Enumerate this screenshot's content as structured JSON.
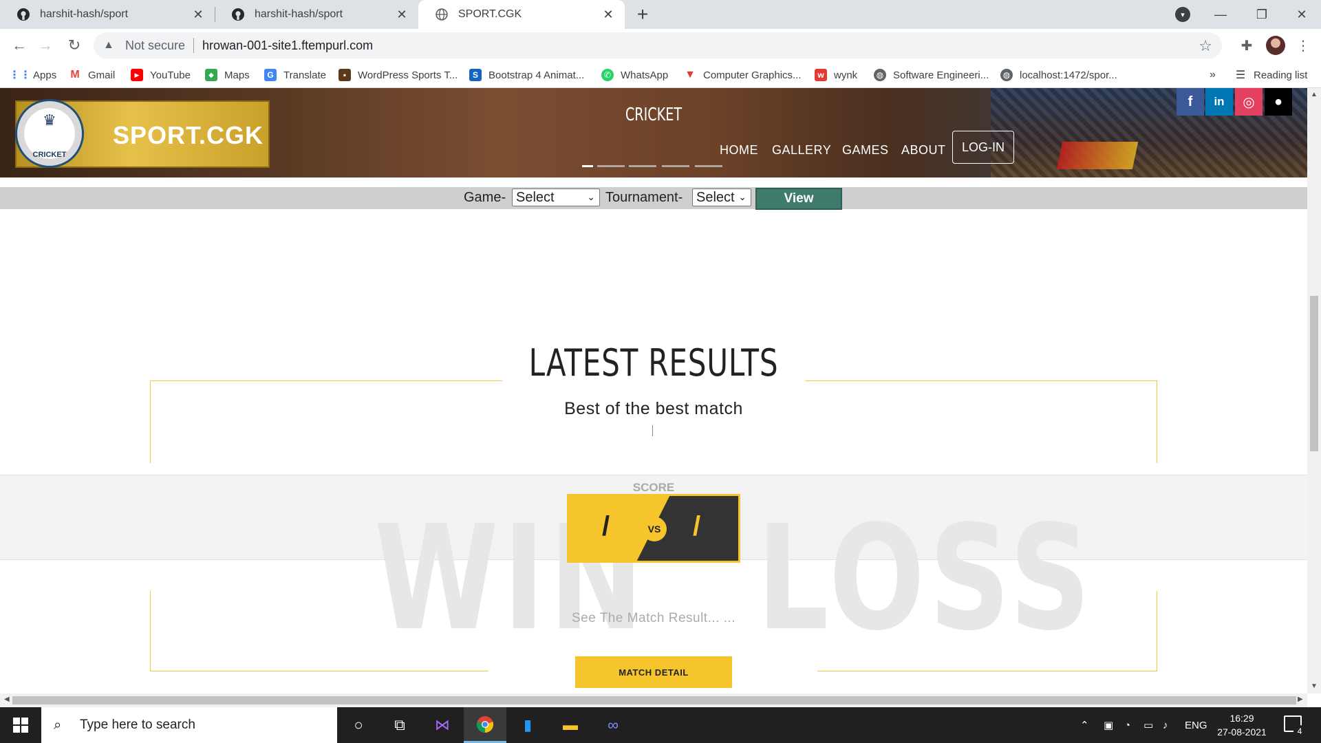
{
  "browser": {
    "tabs": [
      {
        "title": "harshit-hash/sport",
        "icon": "github-icon",
        "active": false
      },
      {
        "title": "harshit-hash/sport",
        "icon": "github-icon",
        "active": false
      },
      {
        "title": "SPORT.CGK",
        "icon": "globe-icon",
        "active": true
      }
    ],
    "close_glyph": "✕",
    "new_tab_glyph": "+",
    "address": {
      "security_label": "Not secure",
      "url": "hrowan-001-site1.ftempurl.com"
    },
    "bookmarks": [
      {
        "label": "Apps",
        "icon": "apps-grid-icon",
        "color": "#4285f4"
      },
      {
        "label": "Gmail",
        "icon": "gmail-icon",
        "color": "#ea4335"
      },
      {
        "label": "YouTube",
        "icon": "youtube-icon",
        "color": "#ff0000"
      },
      {
        "label": "Maps",
        "icon": "maps-icon",
        "color": "#34a853"
      },
      {
        "label": "Translate",
        "icon": "translate-icon",
        "color": "#4285f4"
      },
      {
        "label": "WordPress Sports T...",
        "icon": "wordpress-theme-icon",
        "color": "#5a3a1a"
      },
      {
        "label": "Bootstrap 4 Animat...",
        "icon": "bootstrap-icon",
        "color": "#1565c0"
      },
      {
        "label": "WhatsApp",
        "icon": "whatsapp-icon",
        "color": "#25d366"
      },
      {
        "label": "Computer Graphics...",
        "icon": "graphics-icon",
        "color": "#e53935"
      },
      {
        "label": "wynk",
        "icon": "wynk-icon",
        "color": "#e53935"
      },
      {
        "label": "Software Engineeri...",
        "icon": "globe-icon",
        "color": "#5f6368"
      },
      {
        "label": "localhost:1472/spor...",
        "icon": "globe-icon",
        "color": "#5f6368"
      }
    ],
    "bookmarks_overflow": "»",
    "reading_list": "Reading list"
  },
  "site": {
    "logo_text": "SPORT.CGK",
    "logo_badge_text": "CRICKET",
    "hero_title": "CRICKET",
    "nav": [
      "HOME",
      "GALLERY",
      "GAMES",
      "ABOUT"
    ],
    "login_label": "LOG-IN",
    "social": [
      {
        "name": "facebook-icon",
        "glyph": "f",
        "color": "#3b5998"
      },
      {
        "name": "linkedin-icon",
        "glyph": "in",
        "color": "#0077b5"
      },
      {
        "name": "instagram-icon",
        "glyph": "◎",
        "color": "#e4405f"
      },
      {
        "name": "github-icon",
        "glyph": "●",
        "color": "#000000"
      }
    ],
    "filter": {
      "game_label": "Game-",
      "game_value": "Select",
      "tournament_label": "Tournament-",
      "tournament_value": "Select",
      "view_label": "View"
    },
    "results": {
      "title": "LATEST RESULTS",
      "subtitle": "Best of the best match",
      "score_label": "SCORE",
      "left_score": "/",
      "right_score": "/",
      "vs": "VS",
      "bg_left": "WIN",
      "bg_right": "LOSS",
      "result_text": "See The Match Result... ...",
      "detail_button": "MATCH DETAIL"
    },
    "colors": {
      "accent": "#f6c42b",
      "view_button": "#3f7b6c",
      "dark": "#333333"
    }
  },
  "taskbar": {
    "search_placeholder": "Type here to search",
    "language": "ENG",
    "time": "16:29",
    "date": "27-08-2021",
    "notification_count": "4"
  }
}
